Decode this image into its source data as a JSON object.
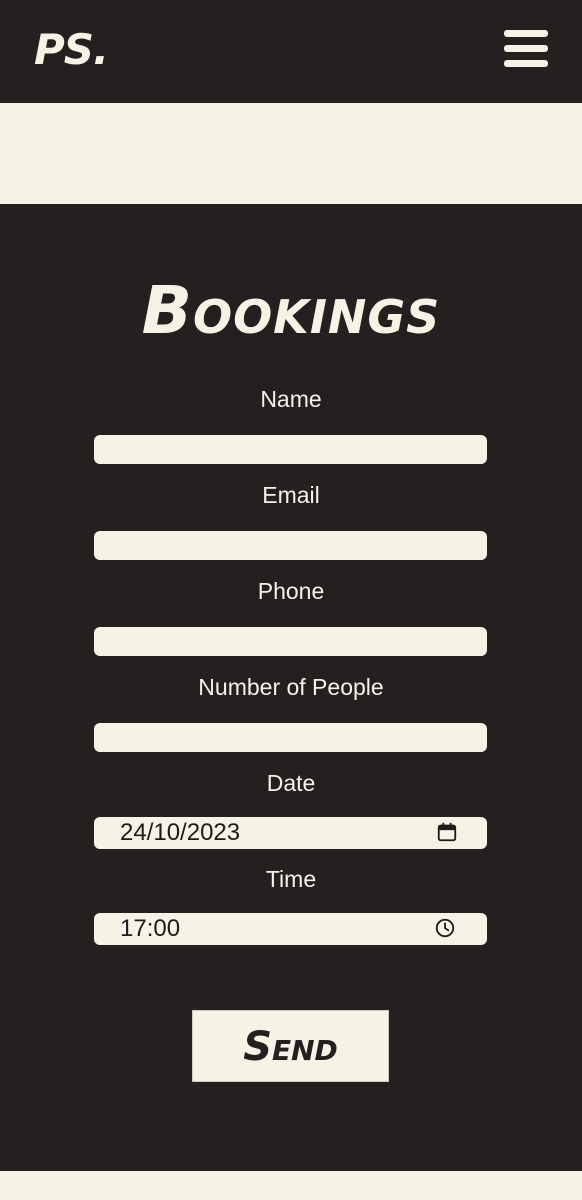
{
  "header": {
    "logo": "PS.",
    "menu_icon": "hamburger-menu-icon"
  },
  "colors": {
    "dark": "#252020",
    "cream": "#f5f2e6"
  },
  "form": {
    "title": "Bookings",
    "fields": {
      "name": {
        "label": "Name",
        "value": ""
      },
      "email": {
        "label": "Email",
        "value": ""
      },
      "phone": {
        "label": "Phone",
        "value": ""
      },
      "people": {
        "label": "Number of People",
        "value": ""
      },
      "date": {
        "label": "Date",
        "value": "24/10/2023",
        "icon": "calendar-icon"
      },
      "time": {
        "label": "Time",
        "value": "17:00",
        "icon": "clock-icon"
      }
    },
    "submit_label": "Send"
  }
}
